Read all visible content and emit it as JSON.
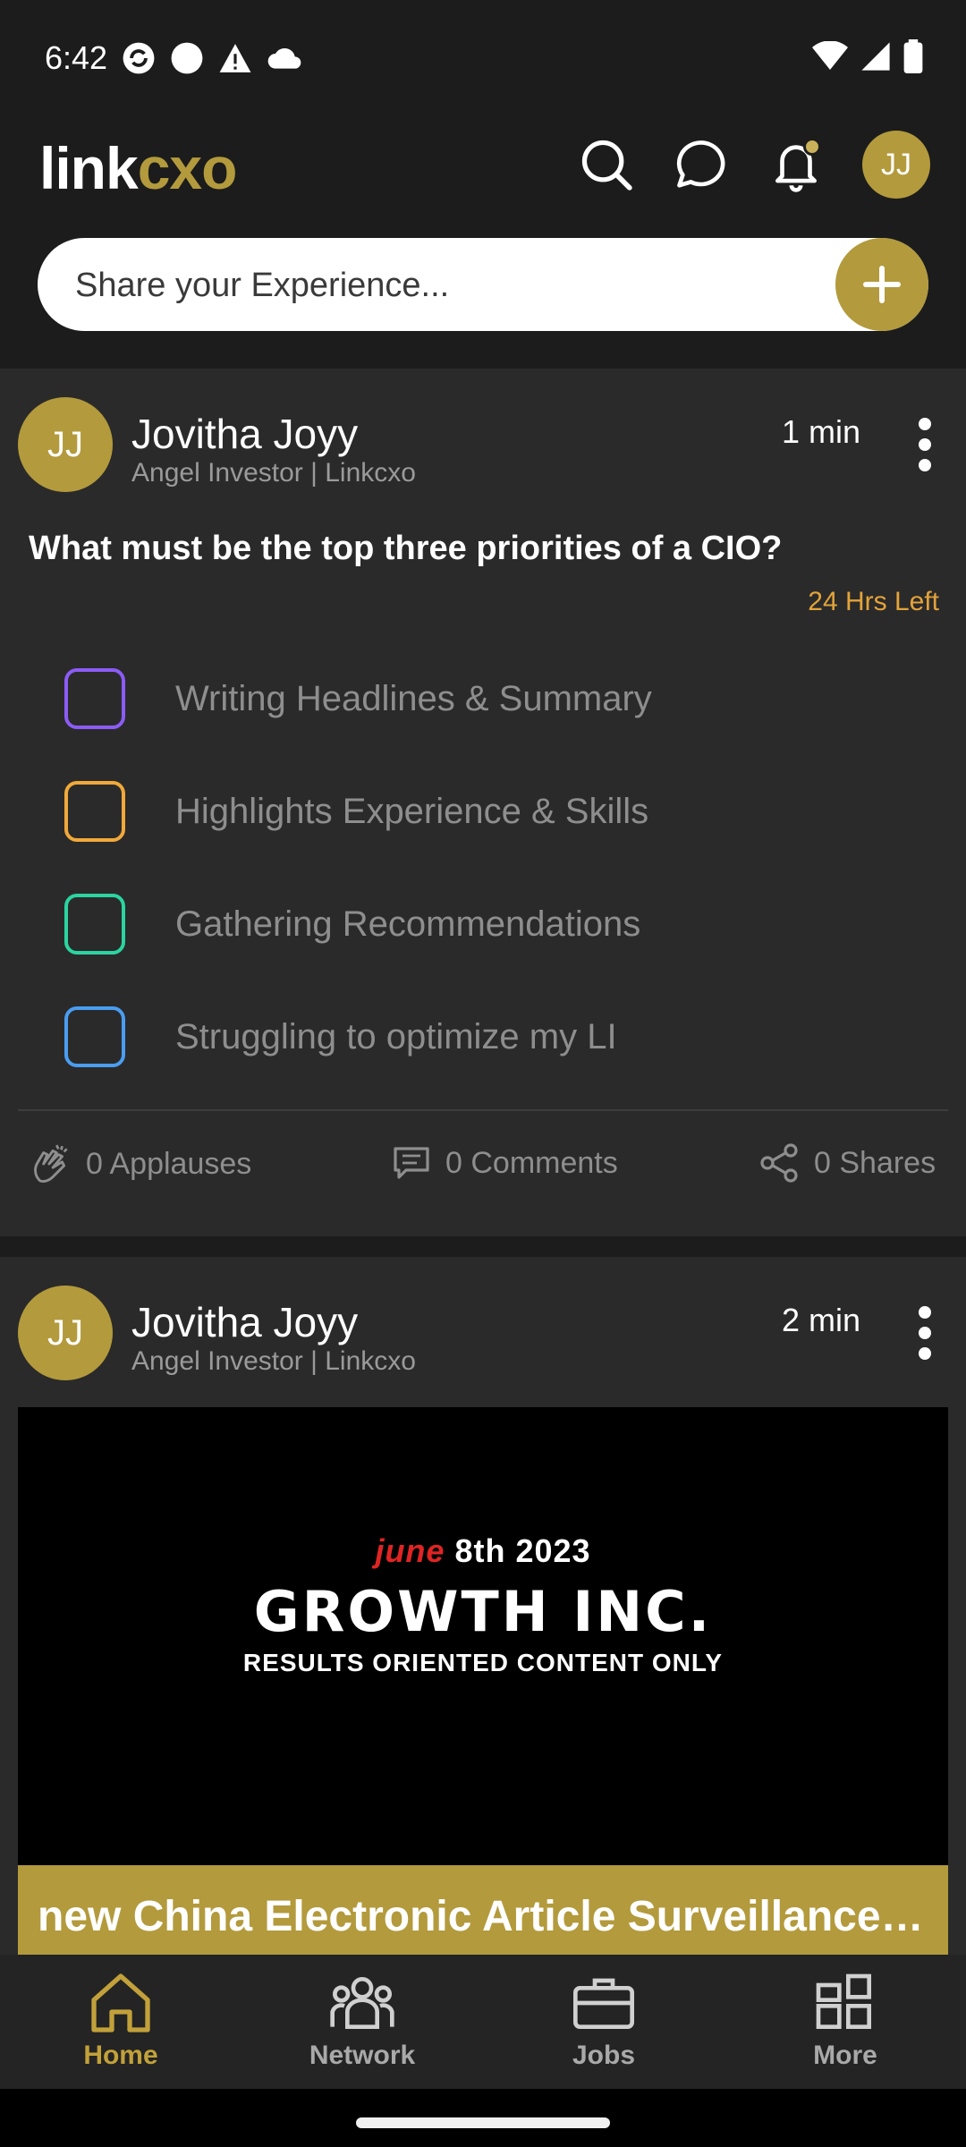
{
  "status_bar": {
    "time": "6:42"
  },
  "header": {
    "logo_link": "link",
    "logo_cxo": "cxo",
    "avatar_initials": "JJ",
    "share_placeholder": "Share your Experience..."
  },
  "posts": [
    {
      "avatar": "JJ",
      "author": "Jovitha Joyy",
      "role": "Angel Investor | Linkcxo",
      "time": "1 min",
      "question": "What must be the top three priorities of a CIO?",
      "time_left": "24 Hrs Left",
      "options": [
        {
          "label": "Writing Headlines & Summary",
          "color": "#8b5cf6"
        },
        {
          "label": "Highlights Experience & Skills",
          "color": "#f0a93a"
        },
        {
          "label": "Gathering Recommendations",
          "color": "#2bd4a0"
        },
        {
          "label": "Struggling to optimize my LI",
          "color": "#4a9df0"
        }
      ],
      "applauses": "0 Applauses",
      "comments": "0 Comments",
      "shares": "0 Shares"
    },
    {
      "avatar": "JJ",
      "author": "Jovitha Joyy",
      "role": "Angel Investor | Linkcxo",
      "time": "2 min",
      "media": {
        "date_month": "june",
        "date_rest": "8th 2023",
        "title": "GROWTH INC.",
        "subtitle": "RESULTS ORIENTED CONTENT ONLY",
        "caption": "new China Electronic Article Surveillance Syste"
      }
    }
  ],
  "bottom_nav": {
    "items": [
      {
        "label": "Home",
        "active": true
      },
      {
        "label": "Network",
        "active": false
      },
      {
        "label": "Jobs",
        "active": false
      },
      {
        "label": "More",
        "active": false
      }
    ]
  },
  "colors": {
    "accent": "#b39a3c",
    "warning": "#e3a33a",
    "background": "#1c1c1c",
    "card": "#2a2a2a"
  }
}
